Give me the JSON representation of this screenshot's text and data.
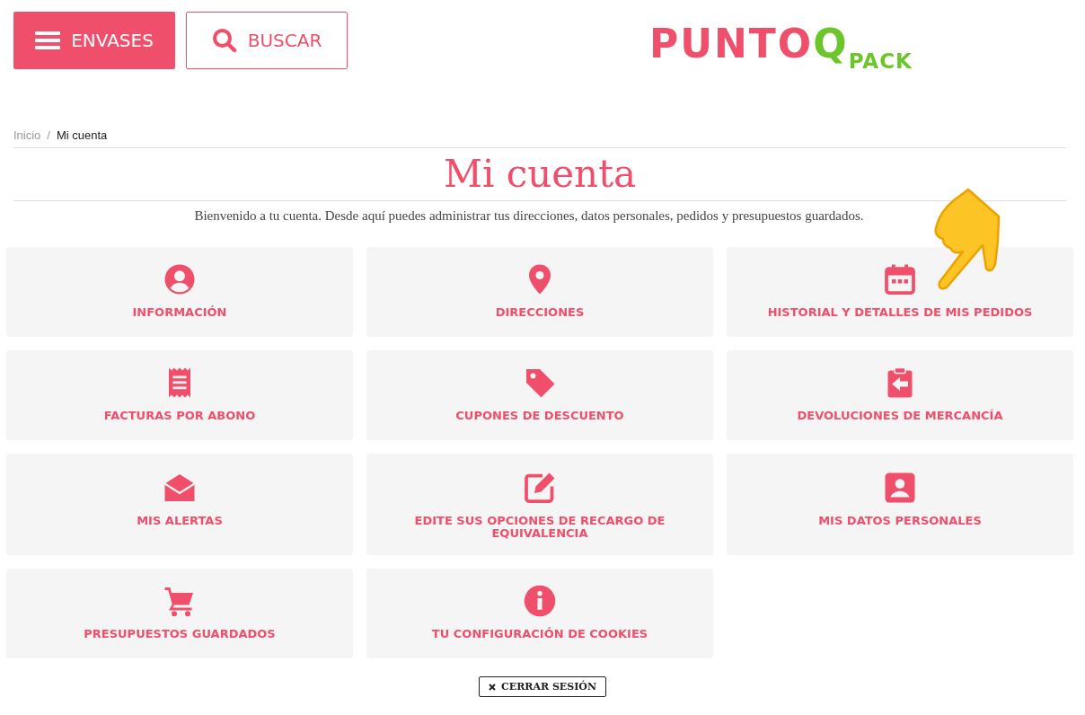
{
  "header": {
    "menu_button": "ENVASES",
    "search_button": "BUSCAR",
    "logo": {
      "main": "PUNTO",
      "accent": "Q",
      "sub": "PACK"
    }
  },
  "breadcrumb": {
    "separator": "/",
    "items": [
      {
        "label": "Inicio",
        "current": false
      },
      {
        "label": "Mi cuenta",
        "current": true
      }
    ]
  },
  "title": "Mi cuenta",
  "intro": "Bienvenido a tu cuenta. Desde aquí puedes administrar tus direcciones, datos personales, pedidos y presupuestos guardados.",
  "cards": [
    {
      "label": "INFORMACIÓN"
    },
    {
      "label": "DIRECCIONES"
    },
    {
      "label": "HISTORIAL Y DETALLES DE MIS PEDIDOS"
    },
    {
      "label": "FACTURAS POR ABONO"
    },
    {
      "label": "CUPONES DE DESCUENTO"
    },
    {
      "label": "DEVOLUCIONES DE MERCANCÍA"
    },
    {
      "label": "MIS ALERTAS"
    },
    {
      "label": "EDITE SUS OPCIONES DE RECARGO DE EQUIVALENCIA"
    },
    {
      "label": "MIS DATOS PERSONALES"
    },
    {
      "label": "PRESUPUESTOS GUARDADOS"
    },
    {
      "label": "TU CONFIGURACIÓN DE COOKIES"
    }
  ],
  "logout_button": "CERRAR SESIÓN"
}
